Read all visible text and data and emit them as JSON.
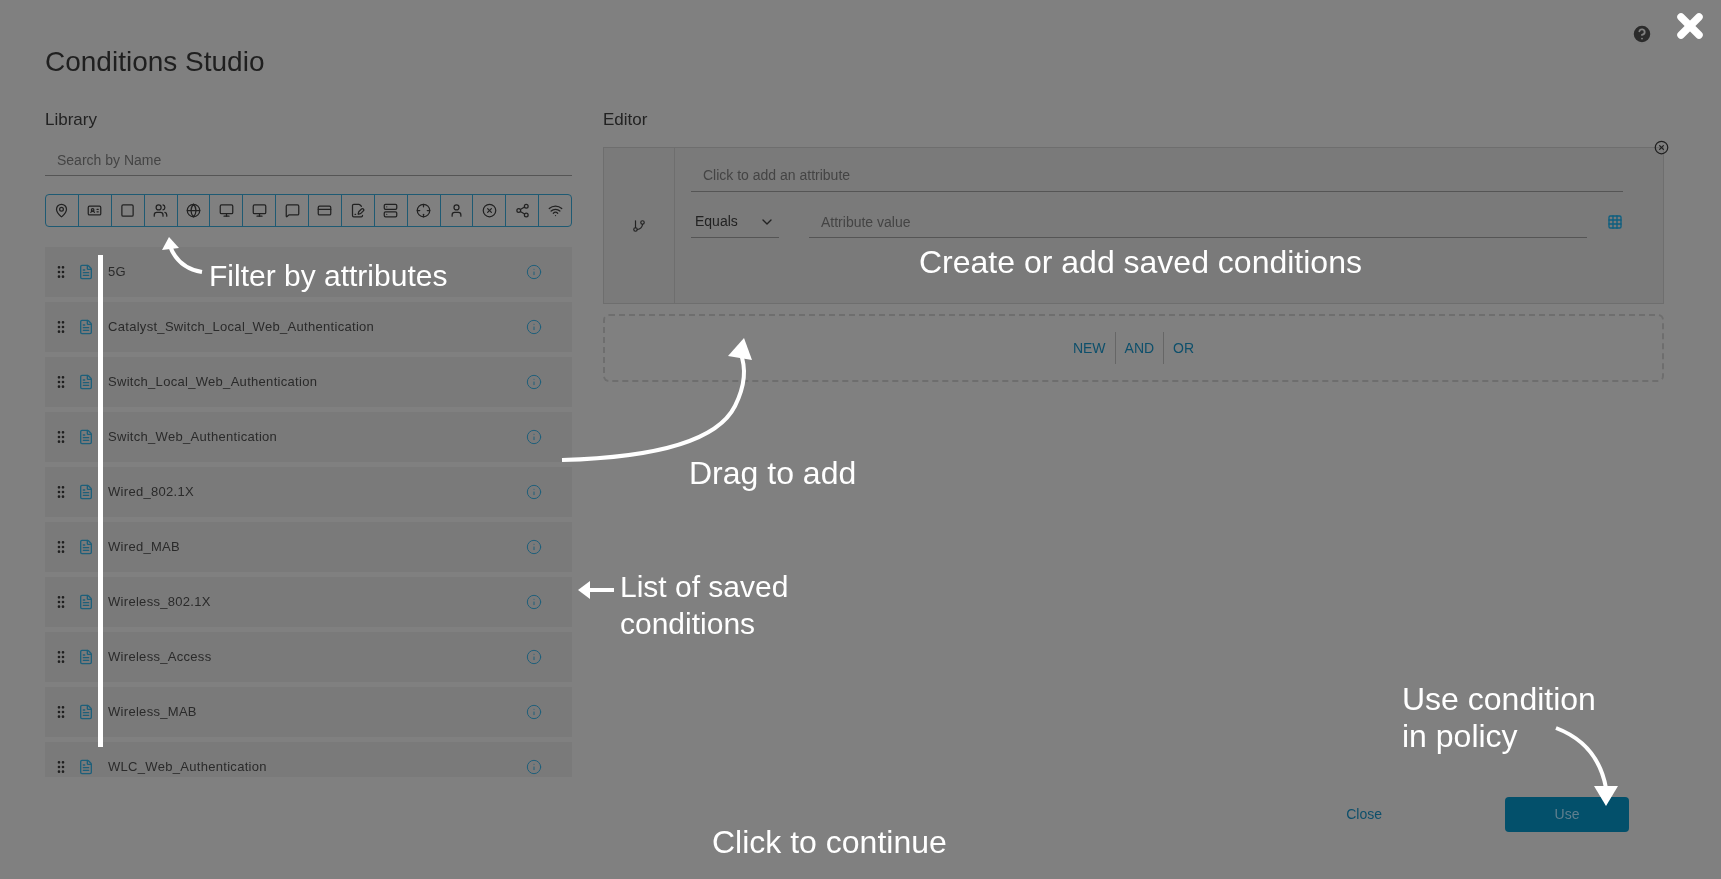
{
  "dialog": {
    "title": "Conditions Studio"
  },
  "library": {
    "heading": "Library",
    "search": {
      "placeholder": "Search by Name"
    },
    "conditions": [
      "5G",
      "Catalyst_Switch_Local_Web_Authentication",
      "Switch_Local_Web_Authentication",
      "Switch_Web_Authentication",
      "Wired_802.1X",
      "Wired_MAB",
      "Wireless_802.1X",
      "Wireless_Access",
      "Wireless_MAB",
      "WLC_Web_Authentication"
    ]
  },
  "editor": {
    "heading": "Editor",
    "attribute": {
      "placeholder": "Click to add an attribute"
    },
    "operator": "Equals",
    "value": {
      "placeholder": "Attribute value"
    },
    "actions": [
      "NEW",
      "AND",
      "OR"
    ]
  },
  "footer": {
    "close": "Close",
    "use": "Use"
  },
  "tutorial": [
    {
      "kind": "filter",
      "text": "Filter by attributes"
    },
    {
      "kind": "list",
      "text": "List of saved conditions"
    },
    {
      "kind": "create",
      "text": "Create or add saved conditions"
    },
    {
      "kind": "drag",
      "text": "Drag to add"
    },
    {
      "kind": "use",
      "text": "Use condition in policy"
    },
    {
      "kind": "continue",
      "text": "Click to continue"
    }
  ]
}
